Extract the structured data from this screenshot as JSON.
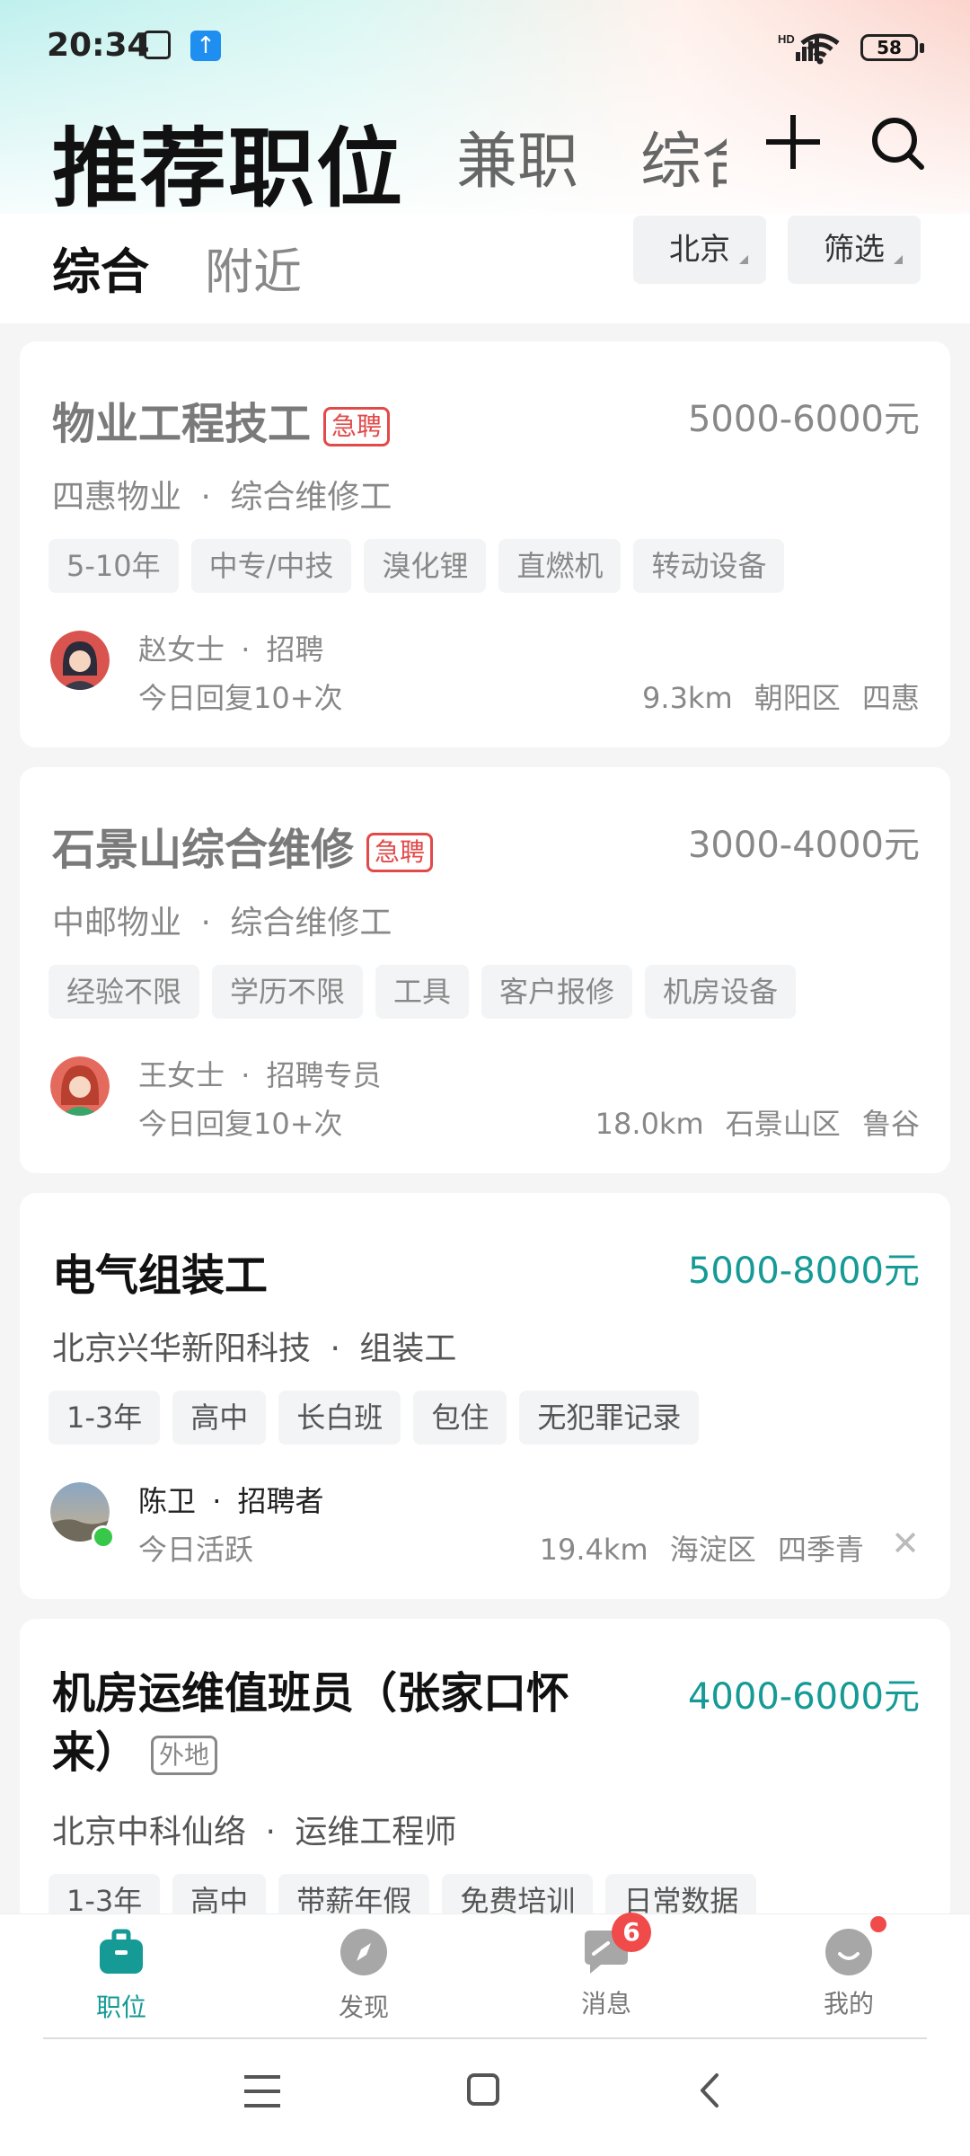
{
  "status_bar": {
    "time": "20:34",
    "battery": "58",
    "net_label": "HD"
  },
  "header": {
    "tabs": [
      "推荐职位",
      "兼职",
      "综合"
    ],
    "plus_icon": "plus-icon",
    "search_icon": "search-icon"
  },
  "subnav": {
    "tabs": [
      "综合",
      "附近"
    ],
    "city": "北京",
    "filter": "筛选"
  },
  "jobs": [
    {
      "title": "物业工程技工",
      "badge": "急聘",
      "salary": "5000-6000元",
      "company": "四惠物业",
      "position": "综合维修工",
      "tags": [
        "5-10年",
        "中专/中技",
        "溴化锂",
        "直燃机",
        "转动设备"
      ],
      "recruiter_name": "赵女士",
      "recruiter_role": "招聘",
      "activity": "今日回复10+次",
      "distance": "9.3km",
      "district": "朝阳区",
      "area": "四惠"
    },
    {
      "title": "石景山综合维修",
      "badge": "急聘",
      "salary": "3000-4000元",
      "company": "中邮物业",
      "position": "综合维修工",
      "tags": [
        "经验不限",
        "学历不限",
        "工具",
        "客户报修",
        "机房设备"
      ],
      "recruiter_name": "王女士",
      "recruiter_role": "招聘专员",
      "activity": "今日回复10+次",
      "distance": "18.0km",
      "district": "石景山区",
      "area": "鲁谷"
    },
    {
      "title": "电气组装工",
      "badge": "",
      "salary": "5000-8000元",
      "company": "北京兴华新阳科技",
      "position": "组装工",
      "tags": [
        "1-3年",
        "高中",
        "长白班",
        "包住",
        "无犯罪记录"
      ],
      "recruiter_name": "陈卫",
      "recruiter_role": "招聘者",
      "activity": "今日活跃",
      "distance": "19.4km",
      "district": "海淀区",
      "area": "四季青"
    },
    {
      "title_line1": "机房运维值班员（张家口怀",
      "title_line2": "来）",
      "badge": "外地",
      "salary": "4000-6000元",
      "company": "北京中科仙络",
      "position": "运维工程师",
      "tags": [
        "1-3年",
        "高中",
        "带薪年假",
        "免费培训",
        "日常数据"
      ]
    }
  ],
  "separator": "·",
  "bottom_nav": {
    "items": [
      {
        "label": "职位",
        "icon": "briefcase-icon"
      },
      {
        "label": "发现",
        "icon": "compass-icon"
      },
      {
        "label": "消息",
        "icon": "chat-icon",
        "badge": "6"
      },
      {
        "label": "我的",
        "icon": "profile-icon"
      }
    ]
  },
  "colors": {
    "accent": "#159a96",
    "urgent": "#e24a4a",
    "badge_red": "#f04a4a"
  }
}
